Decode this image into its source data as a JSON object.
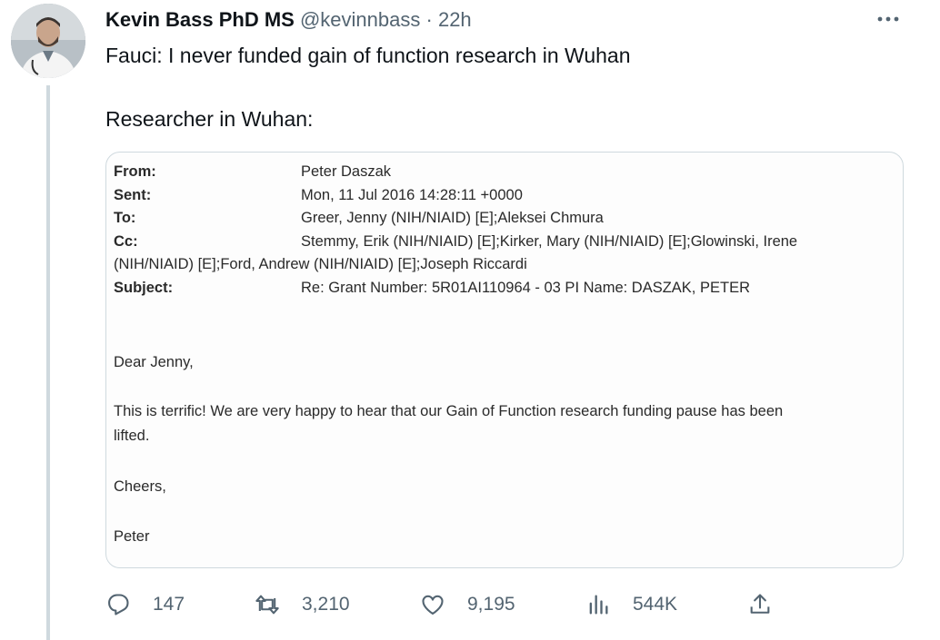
{
  "author": {
    "name": "Kevin Bass PhD MS",
    "handle": "@kevinnbass",
    "separator": "·",
    "time": "22h"
  },
  "more_label": "···",
  "tweet": {
    "line1": "Fauci: I never funded gain of function research in Wuhan",
    "line2": "Researcher in Wuhan:"
  },
  "email": {
    "from_label": "From:",
    "from_value": "Peter Daszak",
    "sent_label": "Sent:",
    "sent_value": "Mon, 11 Jul 2016 14:28:11 +0000",
    "to_label": "To:",
    "to_value": "Greer, Jenny (NIH/NIAID) [E];Aleksei Chmura",
    "cc_label": "Cc:",
    "cc_value_line1": "Stemmy, Erik (NIH/NIAID) [E];Kirker, Mary (NIH/NIAID) [E];Glowinski, Irene",
    "cc_value_line2": "(NIH/NIAID) [E];Ford, Andrew (NIH/NIAID) [E];Joseph Riccardi",
    "subject_label": "Subject:",
    "subject_value": "Re: Grant Number: 5R01AI110964 - 03 PI Name: DASZAK, PETER",
    "greeting": "Dear Jenny,",
    "body_line1": "This is terrific! We are very happy to hear that our Gain of Function research funding pause has been",
    "body_line2": "lifted.",
    "closing": "Cheers,",
    "signature": "Peter"
  },
  "actions": {
    "replies": "147",
    "retweets": "3,210",
    "likes": "9,195",
    "views": "544K"
  },
  "icons": {
    "reply": "reply-icon",
    "retweet": "retweet-icon",
    "like": "heart-icon",
    "views": "views-chart-icon",
    "share": "share-icon",
    "more": "more-dots-icon"
  },
  "colors": {
    "text": "#0f1419",
    "secondary": "#536471",
    "border": "#cfd9de"
  }
}
